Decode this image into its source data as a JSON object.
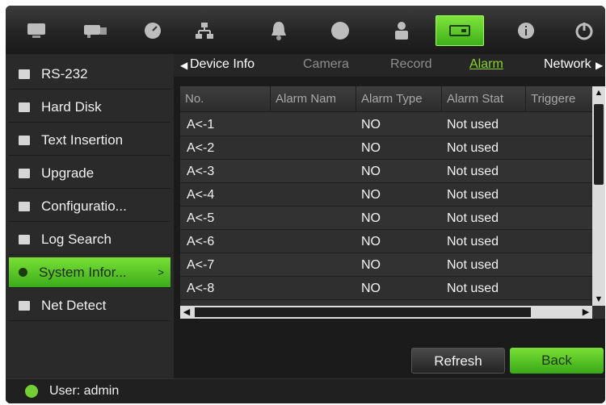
{
  "toolbar": {
    "icons": [
      "monitor-icon",
      "camera-icon",
      "dial-icon",
      "network-icon",
      "alarm-bell-icon",
      "record-icon",
      "user-icon",
      "device-icon",
      "info-icon",
      "power-icon"
    ],
    "active_index": 7
  },
  "sidebar": {
    "items": [
      {
        "label": "RS-232",
        "icon": "serial-icon"
      },
      {
        "label": "Hard Disk",
        "icon": "hdd-icon"
      },
      {
        "label": "Text Insertion",
        "icon": "text-insert-icon"
      },
      {
        "label": "Upgrade",
        "icon": "upgrade-icon"
      },
      {
        "label": "Configuratio...",
        "icon": "config-icon"
      },
      {
        "label": "Log Search",
        "icon": "log-icon"
      },
      {
        "label": "System Infor...",
        "icon": "system-info-icon"
      },
      {
        "label": "Net Detect",
        "icon": "net-detect-icon"
      }
    ],
    "active_index": 6,
    "active_arrow": ">"
  },
  "tabs": {
    "left_arrow": "◀",
    "right_arrow": "▶",
    "items": [
      "Device Info",
      "Camera",
      "Record",
      "Alarm",
      "Network"
    ],
    "active": "Alarm"
  },
  "table": {
    "columns": [
      "No.",
      "Alarm Nam",
      "Alarm Type",
      "Alarm Stat",
      "Triggere"
    ],
    "rows": [
      {
        "no": "A<-1",
        "name": "",
        "type": "NO",
        "status": "Not used",
        "triggered": ""
      },
      {
        "no": "A<-2",
        "name": "",
        "type": "NO",
        "status": "Not used",
        "triggered": ""
      },
      {
        "no": "A<-3",
        "name": "",
        "type": "NO",
        "status": "Not used",
        "triggered": ""
      },
      {
        "no": "A<-4",
        "name": "",
        "type": "NO",
        "status": "Not used",
        "triggered": ""
      },
      {
        "no": "A<-5",
        "name": "",
        "type": "NO",
        "status": "Not used",
        "triggered": ""
      },
      {
        "no": "A<-6",
        "name": "",
        "type": "NO",
        "status": "Not used",
        "triggered": ""
      },
      {
        "no": "A<-7",
        "name": "",
        "type": "NO",
        "status": "Not used",
        "triggered": ""
      },
      {
        "no": "A<-8",
        "name": "",
        "type": "NO",
        "status": "Not used",
        "triggered": ""
      }
    ]
  },
  "buttons": {
    "refresh": "Refresh",
    "back": "Back"
  },
  "status": {
    "user": "User: admin"
  },
  "colors": {
    "accent": "#6fd62e",
    "background": "#1b1b1b",
    "active_tab": "#8ad42a"
  }
}
